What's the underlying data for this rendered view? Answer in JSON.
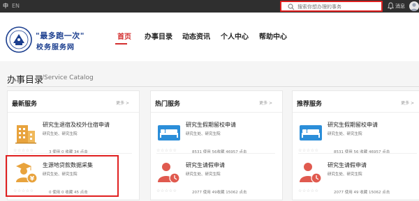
{
  "topbar": {
    "lang_zh": "中",
    "lang_en": "EN",
    "search_placeholder": "搜索你想办理的事务",
    "messages_label": "消息"
  },
  "header": {
    "title_line1": "\"最多跑一次\"",
    "title_line2": "校务服务网",
    "nav": [
      "首页",
      "办事目录",
      "动态资讯",
      "个人中心",
      "帮助中心"
    ],
    "active_nav": "首页"
  },
  "catalog": {
    "title": "办事目录",
    "subtitle": "/Service Catalog"
  },
  "panels": [
    {
      "title": "最新服务",
      "more": "更多 >",
      "items": [
        {
          "name": "研究生退宿及校外住宿申请",
          "dept": "研究生处、研究生院",
          "stats": "3 使用 0 收藏 34 点击",
          "icon": "building-icon"
        },
        {
          "name": "生源地贷款数据采集",
          "dept": "研究生处、研究生院",
          "stats": "0 使用 0 收藏 45 点击",
          "icon": "graduate-yen-icon"
        }
      ]
    },
    {
      "title": "热门服务",
      "more": "更多 >",
      "items": [
        {
          "name": "研究生假期留校申请",
          "dept": "研究生处、研究生院",
          "stats": "8531 使用 56收藏 46957 点击",
          "icon": "bed-icon"
        },
        {
          "name": "研究生请假申请",
          "dept": "研究生处、研究生院",
          "stats": "2077 使用 49收藏 15062 点击",
          "icon": "person-clock-icon"
        }
      ]
    },
    {
      "title": "推荐服务",
      "more": "更多 >",
      "items": [
        {
          "name": "研究生假期留校申请",
          "dept": "研究生处、研究生院",
          "stats": "8531 使用 56 收藏 46957 点击",
          "icon": "bed-icon"
        },
        {
          "name": "研究生请假申请",
          "dept": "研究生处、研究生院",
          "stats": "2077 使用 49 收藏 15062 点击",
          "icon": "person-clock-icon"
        }
      ]
    }
  ],
  "stars": "☆☆☆☆☆",
  "colors": {
    "accent_red": "#d32f2f",
    "brand_blue": "#1c3f8f",
    "icon_orange": "#e8a33d",
    "icon_blue": "#2b8ed9",
    "icon_red": "#e05a4f",
    "topbar": "#2f2f2f"
  }
}
